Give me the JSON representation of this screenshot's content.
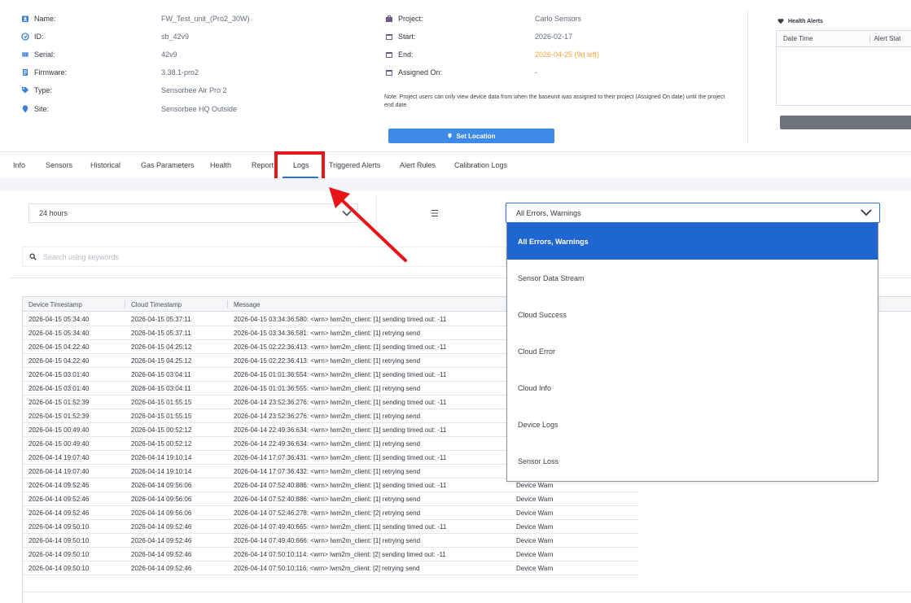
{
  "device": {
    "rows": [
      {
        "label": "Name:",
        "value": "FW_Test_unit_(Pro2_30W)",
        "icon": "badge-icon"
      },
      {
        "label": "ID:",
        "value": "sb_42v9",
        "icon": "id-icon"
      },
      {
        "label": "Serial:",
        "value": "42v9",
        "icon": "serial-icon"
      },
      {
        "label": "Firmware:",
        "value": "3.38.1-pro2",
        "icon": "firmware-icon"
      },
      {
        "label": "Type:",
        "value": "Sensorbee Air Pro 2",
        "icon": "tag-icon"
      },
      {
        "label": "Site:",
        "value": "Sensorbee HQ Outside",
        "icon": "location-pin-icon"
      }
    ]
  },
  "project": {
    "rows": [
      {
        "label": "Project:",
        "value": "Carlo Sensors",
        "icon": "briefcase-icon"
      },
      {
        "label": "Start:",
        "value": "2026-02-17",
        "icon": "calendar-icon"
      },
      {
        "label": "End:",
        "value": "2026-04-25 (9d left)",
        "icon": "calendar-icon"
      },
      {
        "label": "Assigned On:",
        "value": "-",
        "icon": "calendar-icon"
      }
    ],
    "note": "Note: Project users can only view device data from when the baseunit was assigned to their project (Assigned On date) until the project end date",
    "set_location_label": "Set Location"
  },
  "health_alerts": {
    "title": "Health Alerts",
    "columns": [
      "Date Time",
      "Alert Stat"
    ]
  },
  "tabs": [
    "Info",
    "Sensors",
    "Historical",
    "Gas Parameters",
    "Health",
    "Report",
    "Logs",
    "Triggered Alerts",
    "Alert Rules",
    "Calibration Logs"
  ],
  "active_tab": "Logs",
  "filters": {
    "time_range": "24 hours",
    "log_type": "All Errors, Warnings",
    "log_type_options": [
      "All Errors, Warnings",
      "Sensor Data Stream",
      "Cloud Success",
      "Cloud Error",
      "Cloud Info",
      "Device Logs",
      "Sensor Loss"
    ],
    "search_placeholder": "Search using keywords"
  },
  "table": {
    "columns": [
      "Device Timestamp",
      "Cloud Timestamp",
      "Message"
    ],
    "rows": [
      [
        "2026-04-15 05:34:40",
        "2026-04-15 05:37:11",
        "2026-04-15 03:34:36:580: <wrn> lwm2m_client: [1] sending timed out: -11",
        ""
      ],
      [
        "2026-04-15 05:34:40",
        "2026-04-15 05:37:11",
        "2026-04-15 03:34:36:581: <wrn> lwm2m_client: [1] retrying send",
        ""
      ],
      [
        "2026-04-15 04:22:40",
        "2026-04-15 04:25:12",
        "2026-04-15 02:22:36:413: <wrn> lwm2m_client: [1] sending timed out: -11",
        ""
      ],
      [
        "2026-04-15 04:22:40",
        "2026-04-15 04:25:12",
        "2026-04-15 02:22:36:413: <wrn> lwm2m_client: [1] retrying send",
        ""
      ],
      [
        "2026-04-15 03:01:40",
        "2026-04-15 03:04:11",
        "2026-04-15 01:01:36:554: <wrn> lwm2m_client: [1] sending timed out: -11",
        ""
      ],
      [
        "2026-04-15 03:01:40",
        "2026-04-15 03:04:11",
        "2026-04-15 01:01:36:555: <wrn> lwm2m_client: [1] retrying send",
        ""
      ],
      [
        "2026-04-15 01:52:39",
        "2026-04-15 01:55:15",
        "2026-04-14 23:52:36:276: <wrn> lwm2m_client: [1] sending timed out: -11",
        ""
      ],
      [
        "2026-04-15 01:52:39",
        "2026-04-15 01:55:15",
        "2026-04-14 23:52:36:276: <wrn> lwm2m_client: [1] retrying send",
        ""
      ],
      [
        "2026-04-15 00:49:40",
        "2026-04-15 00:52:12",
        "2026-04-14 22:49:36:634: <wrn> lwm2m_client: [1] sending timed out: -11",
        ""
      ],
      [
        "2026-04-15 00:49:40",
        "2026-04-15 00:52:12",
        "2026-04-14 22:49:36:634: <wrn> lwm2m_client: [1] retrying send",
        ""
      ],
      [
        "2026-04-14 19:07:40",
        "2026-04-14 19:10:14",
        "2026-04-14 17:07:36:431: <wrn> lwm2m_client: [1] sending timed out: -11",
        ""
      ],
      [
        "2026-04-14 19:07:40",
        "2026-04-14 19:10:14",
        "2026-04-14 17:07:36:432: <wrn> lwm2m_client: [1] retrying send",
        ""
      ],
      [
        "2026-04-14 09:52:46",
        "2026-04-14 09:56:06",
        "2026-04-14 07:52:40:886: <wrn> lwm2m_client: [1] sending timed out: -11",
        "Device Warn"
      ],
      [
        "2026-04-14 09:52:46",
        "2026-04-14 09:56:06",
        "2026-04-14 07:52:40:886: <wrn> lwm2m_client: [1] retrying send",
        "Device Warn"
      ],
      [
        "2026-04-14 09:52:46",
        "2026-04-14 09:56:06",
        "2026-04-14 07:52:46:278: <wrn> lwm2m_client: [2] retrying send",
        "Device Warn"
      ],
      [
        "2026-04-14 09:50:10",
        "2026-04-14 09:52:46",
        "2026-04-14 07:49:40:665: <wrn> lwm2m_client: [1] sending timed out: -11",
        "Device Warn"
      ],
      [
        "2026-04-14 09:50:10",
        "2026-04-14 09:52:46",
        "2026-04-14 07:49:40:666: <wrn> lwm2m_client: [1] retrying send",
        "Device Warn"
      ],
      [
        "2026-04-14 09:50:10",
        "2026-04-14 09:52:46",
        "2026-04-14 07:50:10:114: <wrn> lwm2m_client: [2] sending timed out: -11",
        "Device Warn"
      ],
      [
        "2026-04-14 09:50:10",
        "2026-04-14 09:52:46",
        "2026-04-14 07:50:10:116: <wrn> lwm2m_client: [2] retrying send",
        "Device Warn"
      ]
    ]
  },
  "colors": {
    "accent": "#2d72d2",
    "highlight": "#e8141a",
    "orange": "#f2a33a",
    "selected_option": "#1f66d1"
  }
}
